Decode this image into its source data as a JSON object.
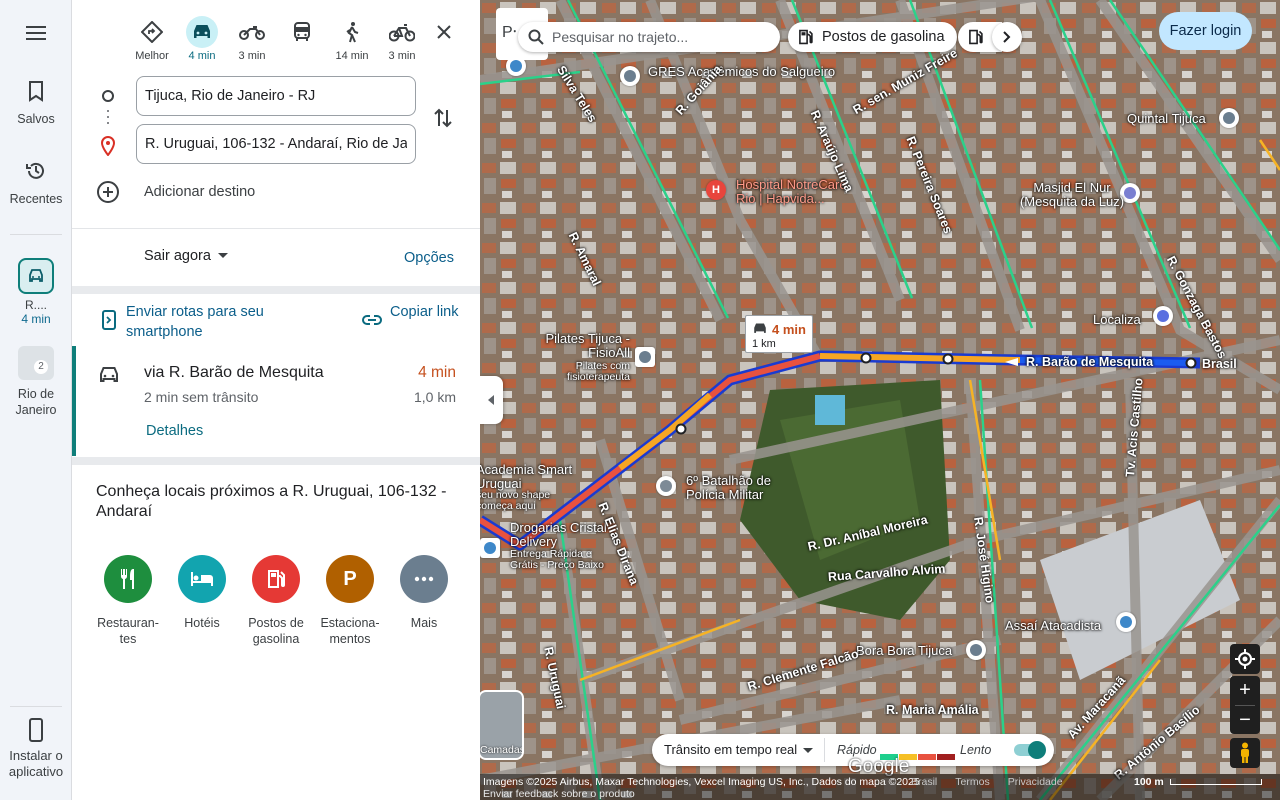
{
  "rail": {
    "saved_label": "Salvos",
    "recent_label": "Recentes",
    "route_chip_title": "R....",
    "route_chip_time": "4 min",
    "rio_chip_label": "Rio de Janeiro",
    "rio_chip_count": "2",
    "install_label": "Instalar o aplicativo"
  },
  "directions": {
    "modes": [
      {
        "name": "Melhor",
        "label": "Melhor",
        "icon": "diamond-route-icon"
      },
      {
        "name": "car",
        "label": "4 min",
        "icon": "car-icon",
        "active": true
      },
      {
        "name": "motorcycle",
        "label": "3 min",
        "icon": "motorcycle-icon"
      },
      {
        "name": "transit",
        "label": "",
        "icon": "bus-icon"
      },
      {
        "name": "walk",
        "label": "14 min",
        "icon": "walk-icon"
      },
      {
        "name": "bike",
        "label": "3 min",
        "icon": "bike-icon"
      }
    ],
    "origin": "Tijuca, Rio de Janeiro - RJ",
    "destination": "R. Uruguai, 106-132 - Andaraí, Rio de Janeiro",
    "add_destination": "Adicionar destino",
    "depart_label": "Sair agora",
    "options_label": "Opções",
    "send_to_phone": "Enviar rotas para seu smartphone",
    "copy_link": "Copiar link",
    "route": {
      "name": "via R. Barão de Mesquita",
      "subtitle": "2 min sem trânsito",
      "time": "4 min",
      "distance": "1,0 km",
      "details_label": "Detalhes"
    },
    "nearby_title": "Conheça locais próximos a R. Uruguai, 106-132 - Andaraí",
    "categories": [
      {
        "label": "Restauran-tes",
        "icon": "fork-knife-icon",
        "color": "#1e8e3e"
      },
      {
        "label": "Hotéis",
        "icon": "bed-icon",
        "color": "#12a4af"
      },
      {
        "label": "Postos de gasolina",
        "icon": "gas-pump-icon",
        "color": "#e53935"
      },
      {
        "label": "Estaciona-mentos",
        "icon": "parking-icon",
        "color": "#b06000"
      },
      {
        "label": "Mais",
        "icon": "more-dots-icon",
        "color": "#6b7e8f"
      }
    ]
  },
  "map": {
    "search_placeholder": "Pesquisar no trajeto...",
    "chip_gas": "Postos de gasolina",
    "login_label": "Fazer login",
    "route_callout_time": "4 min",
    "route_callout_distance": "1 km",
    "pois": [
      "GRES Acadêmicos do Salgueiro",
      "Quintal Tijuca",
      "Hospital NotreCare Rio | Hapvida...",
      "Masjid El Nur (Mesquita da Luz)",
      "Localiza",
      "Pilates Tijuca - FisioAll",
      "Pilates com fisioterapeuta",
      "6º Batalhão de Polícia Militar",
      "Academia Smart Uruguai",
      "seu novo shape começa aqui",
      "Drogarias Cristal Delivery",
      "Entrega Rápida e Grátis - Preço Baixo",
      "Assaí Atacadista",
      "Bora Bora Tijuca"
    ],
    "streets": [
      "R. Barão de Mesquita",
      "Brasil",
      "R. Dr. Aníbal Moreira",
      "Rua Carvalho Alvim",
      "R. Clemente Falcão",
      "R. Maria Amália",
      "R. José Higino",
      "Tv. Acis Castilho",
      "R. Uruguai",
      "R. Amaral",
      "R. Elias Dirana",
      "R. Araújo Lima",
      "R. Pereira Soares",
      "R. Gonzaga Bastos",
      "R. sen. Muniz Freire",
      "R. Goiânia",
      "Av. Maracanã",
      "R. Antônio Basílio",
      "Silva Teles"
    ],
    "layers_label": "Camadas",
    "traffic_label": "Trânsito em tempo real",
    "legend_fast": "Rápido",
    "legend_slow": "Lento",
    "legend_colors": [
      "#1ecf8d",
      "#f6c026",
      "#e8523f",
      "#a11f1f"
    ],
    "google_logo": "Google",
    "attribution": "Imagens ©2025 Airbus, Maxar Technologies, Vexcel Imaging US, Inc., Dados do mapa ©2025",
    "attr_links": [
      "Brasil",
      "Termos",
      "Privacidade"
    ],
    "feedback": "Enviar feedback sobre o produto",
    "scale": "100 m"
  }
}
